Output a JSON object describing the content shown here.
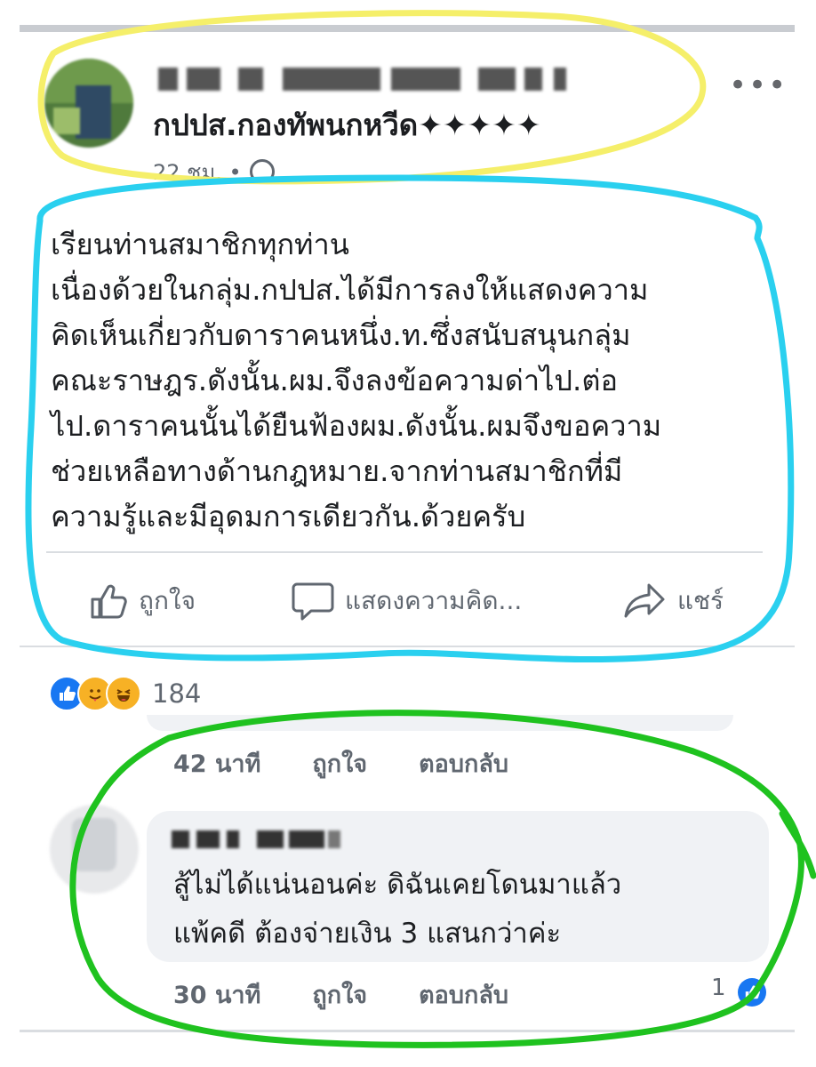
{
  "post": {
    "group_name": "กปปส.กองทัพนกหวีด✦✦✦✦✦",
    "time": "22 ชม. •",
    "more_label": "•••",
    "body_lines": [
      "เรียนท่านสมาชิกทุกท่าน",
      "เนื่องด้วยในกลุ่ม.กปปส.ได้มีการลงให้แสดงความ",
      "คิดเห็นเกี่ยวกับดาราคนหนึ่ง.ท.ซึ่งสนับสนุนกลุ่ม",
      "คณะราษฎร.ดังนั้น.ผม.จึงลงข้อความด่าไป.ต่อ",
      "ไป.ดาราคนนั้นได้ยืนฟ้องผม.ดังนั้น.ผมจึงขอความ",
      "ช่วยเหลือทางด้านกฎหมาย.จากท่านสมาชิกที่มี",
      "ความรู้และมีอุดมการเดียวกัน.ด้วยครับ"
    ],
    "actions": {
      "like": "ถูกใจ",
      "comment": "แสดงความคิด...",
      "share": "แชร์"
    },
    "reaction_count": "184"
  },
  "comments": {
    "previous_meta": {
      "time": "42 นาที",
      "like": "ถูกใจ",
      "reply": "ตอบกลับ"
    },
    "comment": {
      "text_lines": [
        "สู้ไม่ได้แน่นอนค่ะ ดิฉันเคยโดนมาแล้ว",
        "แพ้คดี ต้องจ่ายเงิน 3 แสนกว่าค่ะ"
      ],
      "time": "30 นาที",
      "like": "ถูกใจ",
      "reply": "ตอบกลับ",
      "like_count": "1"
    }
  },
  "colors": {
    "annotation_yellow": "#f5ef6a",
    "annotation_cyan": "#2ad0ef",
    "annotation_green": "#1fc21f",
    "facebook_blue": "#1877f2"
  },
  "icons": [
    "globe-icon",
    "more-icon",
    "thumbs-up-icon",
    "comment-icon",
    "share-icon",
    "like-reaction-icon",
    "care-reaction-icon",
    "haha-reaction-icon"
  ]
}
